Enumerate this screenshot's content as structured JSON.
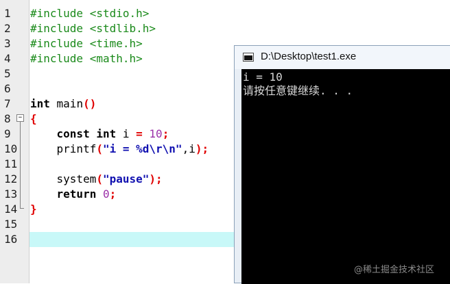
{
  "editor": {
    "lines": [
      {
        "n": "1",
        "tokens": [
          {
            "t": "#include <stdio.h>",
            "c": "pp"
          }
        ]
      },
      {
        "n": "2",
        "tokens": [
          {
            "t": "#include <stdlib.h>",
            "c": "pp"
          }
        ]
      },
      {
        "n": "3",
        "tokens": [
          {
            "t": "#include <time.h>",
            "c": "pp"
          }
        ]
      },
      {
        "n": "4",
        "tokens": [
          {
            "t": "#include <math.h>",
            "c": "pp"
          }
        ]
      },
      {
        "n": "5",
        "tokens": []
      },
      {
        "n": "6",
        "tokens": []
      },
      {
        "n": "7",
        "tokens": [
          {
            "t": "int",
            "c": "kw"
          },
          {
            "t": " main",
            "c": "plain"
          },
          {
            "t": "()",
            "c": "sym"
          }
        ]
      },
      {
        "n": "8",
        "tokens": [
          {
            "t": "{",
            "c": "sym"
          }
        ]
      },
      {
        "n": "9",
        "tokens": [
          {
            "t": "    ",
            "c": "plain"
          },
          {
            "t": "const int",
            "c": "kw"
          },
          {
            "t": " i ",
            "c": "plain"
          },
          {
            "t": "=",
            "c": "sym"
          },
          {
            "t": " ",
            "c": "plain"
          },
          {
            "t": "10",
            "c": "num"
          },
          {
            "t": ";",
            "c": "sym"
          }
        ]
      },
      {
        "n": "10",
        "tokens": [
          {
            "t": "    printf",
            "c": "plain"
          },
          {
            "t": "(",
            "c": "sym"
          },
          {
            "t": "\"i = %d\\r\\n\"",
            "c": "str"
          },
          {
            "t": ",i",
            "c": "plain"
          },
          {
            "t": ");",
            "c": "sym"
          }
        ]
      },
      {
        "n": "11",
        "tokens": []
      },
      {
        "n": "12",
        "tokens": [
          {
            "t": "    system",
            "c": "plain"
          },
          {
            "t": "(",
            "c": "sym"
          },
          {
            "t": "\"pause\"",
            "c": "str"
          },
          {
            "t": ");",
            "c": "sym"
          }
        ]
      },
      {
        "n": "13",
        "tokens": [
          {
            "t": "    ",
            "c": "plain"
          },
          {
            "t": "return",
            "c": "kw"
          },
          {
            "t": " ",
            "c": "plain"
          },
          {
            "t": "0",
            "c": "num"
          },
          {
            "t": ";",
            "c": "sym"
          }
        ]
      },
      {
        "n": "14",
        "tokens": [
          {
            "t": "}",
            "c": "sym"
          }
        ]
      },
      {
        "n": "15",
        "tokens": []
      },
      {
        "n": "16",
        "tokens": []
      }
    ],
    "fold_symbol": "−",
    "current_line": "16"
  },
  "console": {
    "title": "D:\\Desktop\\test1.exe",
    "output": [
      "i = 10",
      "请按任意键继续. . ."
    ]
  },
  "watermark": "@稀土掘金技术社区",
  "colors": {
    "preprocessor": "#1a8a1a",
    "keyword": "#000000",
    "symbol": "#e00000",
    "number": "#9b2fa8",
    "string": "#1010b0",
    "current_line_bg": "#c8f8f8",
    "console_bg": "#000000"
  }
}
